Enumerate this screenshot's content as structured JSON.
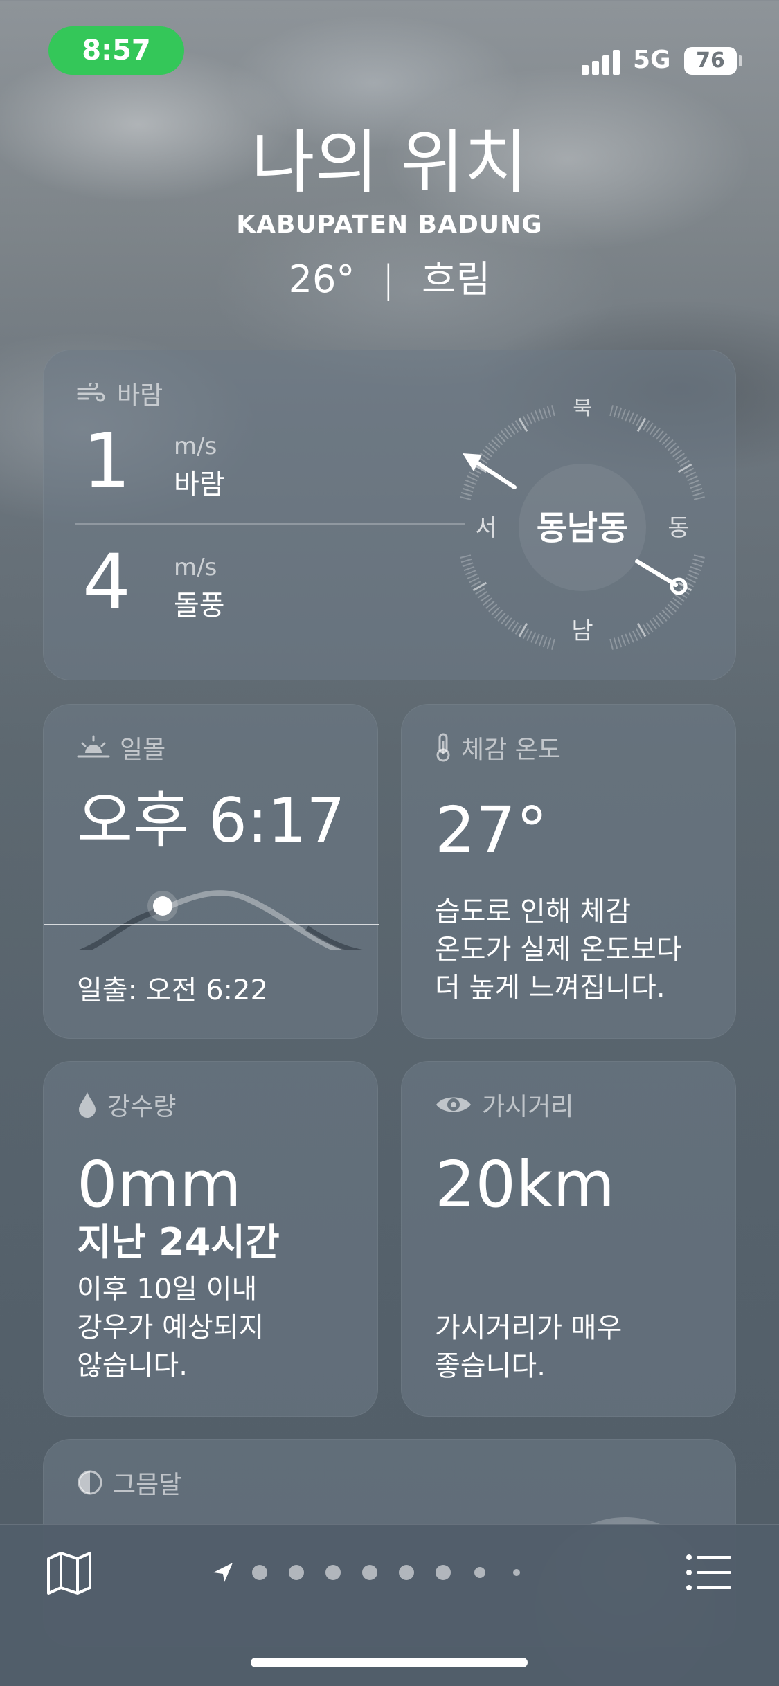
{
  "status_bar": {
    "time": "8:57",
    "network": "5G",
    "battery": "76"
  },
  "location": {
    "title": "나의 위치",
    "place": "KABUPATEN BADUNG",
    "temp": "26°",
    "condition": "흐림"
  },
  "wind": {
    "label": "바람",
    "speed_value": "1",
    "speed_unit": "m/s",
    "speed_label": "바람",
    "gust_value": "4",
    "gust_unit": "m/s",
    "gust_label": "돌풍",
    "direction": "동남동",
    "compass": {
      "north": "북",
      "south": "남",
      "east": "동",
      "west": "서"
    }
  },
  "sunset": {
    "label": "일몰",
    "time": "오후 6:17",
    "sunrise": "일출: 오전 6:22"
  },
  "feels_like": {
    "label": "체감 온도",
    "value": "27°",
    "desc_1": "습도로 인해 체감",
    "desc_2": "온도가 실제 온도보다",
    "desc_3": "더 높게 느껴집니다."
  },
  "precipitation": {
    "label": "강수량",
    "value": "0mm",
    "period": "지난 24시간",
    "desc_1": "이후 10일 이내",
    "desc_2": "강우가 예상되지",
    "desc_3": "않습니다."
  },
  "visibility": {
    "label": "가시거리",
    "value": "20km",
    "desc_1": "가시거리가 매우",
    "desc_2": "좋습니다."
  },
  "moon": {
    "label": "그믐달"
  },
  "tab_bar": {
    "page_count": 9,
    "current_page": 0,
    "icons": [
      "map-icon",
      "location-arrow-icon",
      "list-icon"
    ]
  },
  "colors": {
    "time_pill": "#34c759"
  }
}
